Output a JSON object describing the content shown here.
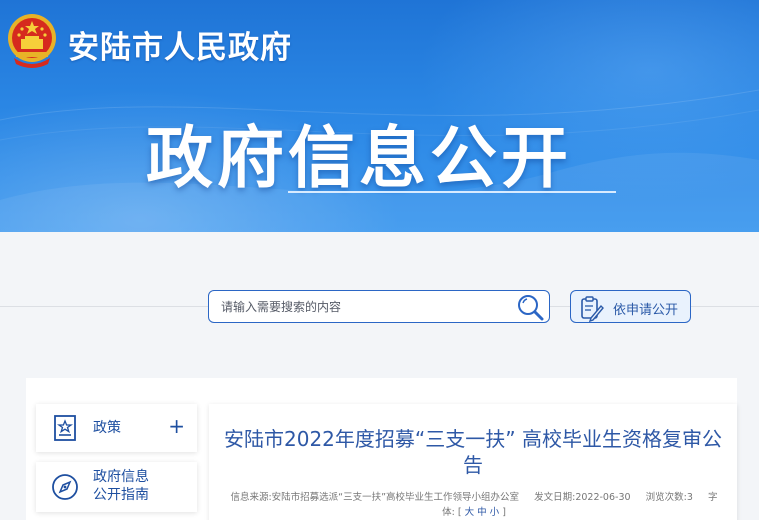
{
  "header": {
    "site_title": "安陆市人民政府",
    "main_heading": "政府信息公开"
  },
  "search": {
    "placeholder": "请输入需要搜索的内容",
    "apply_label": "依申请公开"
  },
  "sidebar": {
    "items": [
      {
        "label": "政策",
        "has_plus": true
      },
      {
        "label_line1": "政府信息",
        "label_line2": "公开指南"
      }
    ],
    "plus_symbol": "+"
  },
  "article": {
    "title": "安陆市2022年度招募“三支一扶” 高校毕业生资格复审公告",
    "source_label": "信息来源:",
    "source": "安陆市招募选派“三支一扶”高校毕业生工作领导小组办公室",
    "date_label": "发文日期:",
    "date": "2022-06-30",
    "views_label": "浏览次数:",
    "views": "3",
    "font_label": "字体:",
    "font_open": "[",
    "font_large": "大",
    "font_medium": "中",
    "font_small": "小",
    "font_close": "]"
  },
  "colors": {
    "banner": "#2a86e4",
    "accent": "#2b66c5",
    "title_blue": "#2e58a6"
  }
}
